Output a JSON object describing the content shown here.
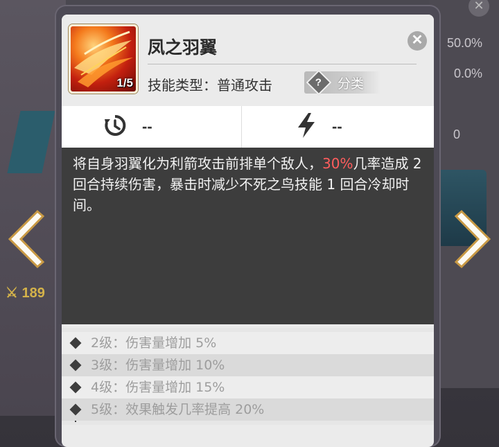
{
  "background": {
    "pct1": "50.0%",
    "pct2": "0.0%",
    "zero": "0",
    "power": "189"
  },
  "skill": {
    "name": "凤之羽翼",
    "level_badge": "1/5",
    "type_label": "技能类型：普通攻击",
    "category_label": "分类",
    "category_icon_text": "?",
    "icon": "phoenix-wing-skill-icon"
  },
  "stats": {
    "cooldown_value": "--",
    "energy_value": "--"
  },
  "description": {
    "part1": "将自身羽翼化为利箭攻击前排单个敌人，",
    "highlight": "30%",
    "part2": "几率造成 2 回合持续伤害，暴击时减少不死之鸟技能 1 回合冷却时间。",
    "highlight_color": "#ff5d5d"
  },
  "upgrades": [
    {
      "text": "2级：伤害量增加 5%"
    },
    {
      "text": "3级：伤害量增加 10%"
    },
    {
      "text": "4级：伤害量增加 15%"
    },
    {
      "text": "5级：效果触发几率提高 20%"
    }
  ],
  "colors": {
    "panel_bg": "#4d4a55",
    "card_bg": "#ebebeb",
    "desc_bg": "#3d3d3d"
  }
}
